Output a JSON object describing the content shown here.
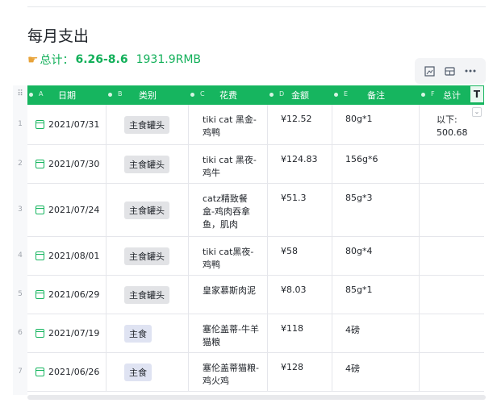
{
  "page": {
    "title": "每月支出",
    "summary": {
      "label": "总计：",
      "range": "6.26-8.6",
      "total": "1931.9RMB"
    }
  },
  "toolbar": {
    "icons": [
      "image-icon",
      "card-view-icon",
      "more-icon"
    ]
  },
  "table": {
    "columns": [
      {
        "letter": "A",
        "label": "日期"
      },
      {
        "letter": "B",
        "label": "类别"
      },
      {
        "letter": "C",
        "label": "花费"
      },
      {
        "letter": "D",
        "label": "金额"
      },
      {
        "letter": "E",
        "label": "备注"
      },
      {
        "letter": "F",
        "label": "总计"
      }
    ],
    "t_button": "T",
    "rows": [
      {
        "num": "1",
        "date": "2021/07/31",
        "category": "主食罐头",
        "item": "tiki cat 黑金-鸡鸭",
        "amount": "¥12.52",
        "note": "80g*1",
        "total": "以下: 500.68"
      },
      {
        "num": "2",
        "date": "2021/07/30",
        "category": "主食罐头",
        "item": "tiki cat 黑夜-鸡牛",
        "amount": "¥124.83",
        "note": "156g*6",
        "total": ""
      },
      {
        "num": "3",
        "date": "2021/07/24",
        "category": "主食罐头",
        "item": "catz精致餐盒-鸡肉吞拿鱼，肌肉",
        "amount": "¥51.3",
        "note": "85g*3",
        "total": ""
      },
      {
        "num": "4",
        "date": "2021/08/01",
        "category": "主食罐头",
        "item": "tiki cat黑夜-鸡鸭",
        "amount": "¥58",
        "note": "80g*4",
        "total": ""
      },
      {
        "num": "5",
        "date": "2021/06/29",
        "category": "主食罐头",
        "item": "皇家慕斯肉泥",
        "amount": "¥8.03",
        "note": "85g*1",
        "total": ""
      },
      {
        "num": "6",
        "date": "2021/07/19",
        "category": "主食",
        "item": "塞伦盖蒂-牛羊猫粮",
        "amount": "¥118",
        "note": "4磅",
        "total": ""
      },
      {
        "num": "7",
        "date": "2021/06/26",
        "category": "主食",
        "item": "塞伦盖蒂猫粮-鸡火鸡",
        "amount": "¥128",
        "note": "4磅",
        "total": ""
      }
    ]
  }
}
